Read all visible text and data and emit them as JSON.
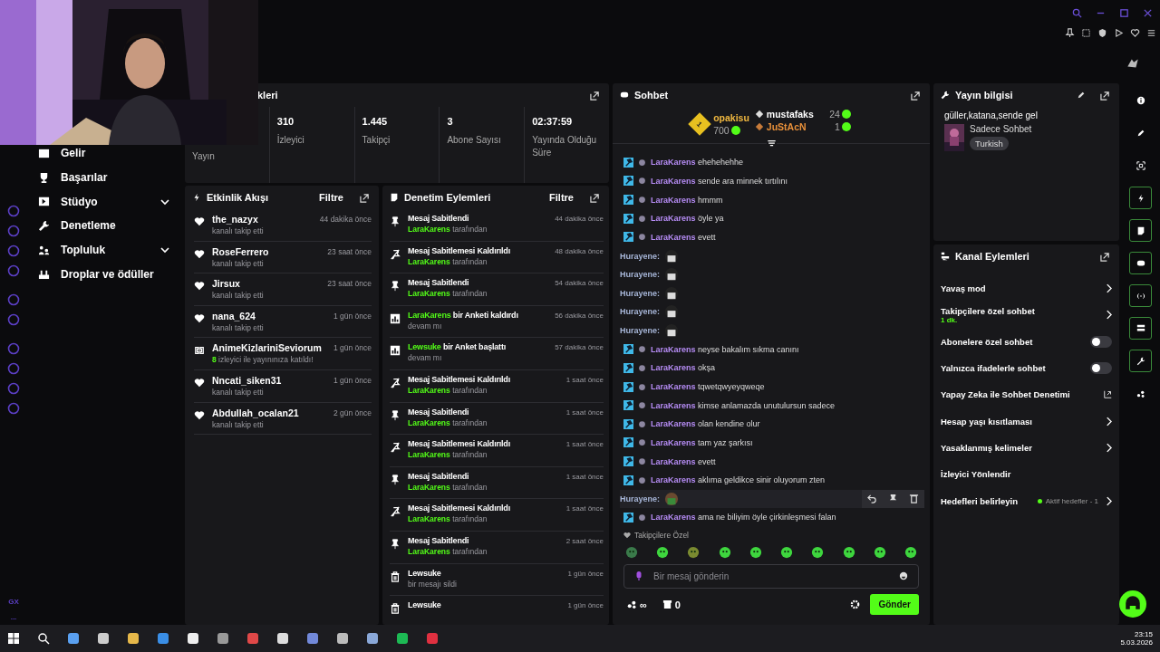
{
  "stats": {
    "title": "kleri",
    "items": [
      {
        "label": "Yayın"
      },
      {
        "value": "310",
        "label": "İzleyici"
      },
      {
        "value": "1.445",
        "label": "Takipçi"
      },
      {
        "value": "3",
        "label": "Abone Sayısı"
      },
      {
        "value": "02:37:59",
        "label": "Yayında Olduğu Süre"
      }
    ]
  },
  "nav": [
    {
      "label": "Gelir",
      "expandable": false
    },
    {
      "label": "Başarılar",
      "expandable": false
    },
    {
      "label": "Stüdyo",
      "expandable": true
    },
    {
      "label": "Denetleme",
      "expandable": false
    },
    {
      "label": "Topluluk",
      "expandable": true
    },
    {
      "label": "Droplar ve ödüller",
      "expandable": false
    }
  ],
  "browser_rail": {
    "badge": "GX",
    "more": "..."
  },
  "activity": {
    "title": "Etkinlik Akışı",
    "filter": "Filtre",
    "items": [
      {
        "kind": "follow",
        "user": "the_nazyx",
        "text": "kanalı takip etti",
        "time": "44 dakika önce"
      },
      {
        "kind": "follow",
        "user": "RoseFerrero",
        "text": "kanalı takip etti",
        "time": "23 saat önce"
      },
      {
        "kind": "follow",
        "user": "Jirsux",
        "text": "kanalı takip etti",
        "time": "23 saat önce"
      },
      {
        "kind": "follow",
        "user": "nana_624",
        "text": "kanalı takip etti",
        "time": "1 gün önce"
      },
      {
        "kind": "raid",
        "user": "AnimeKizlariniSeviorum",
        "count": "8",
        "text": "izleyici ile yayınınıza katıldı!",
        "time": "1 gün önce"
      },
      {
        "kind": "follow",
        "user": "Nncati_siken31",
        "text": "kanalı takip etti",
        "time": "1 gün önce"
      },
      {
        "kind": "follow",
        "user": "Abdullah_ocalan21",
        "text": "kanalı takip etti",
        "time": "2 gün önce"
      }
    ]
  },
  "moderation": {
    "title": "Denetim Eylemleri",
    "filter": "Filtre",
    "items": [
      {
        "kind": "pin",
        "title": "Mesaj Sabitlendi",
        "by_user": "LaraKarens",
        "by_text": "tarafından",
        "time": "44 dakika önce"
      },
      {
        "kind": "unpin",
        "title": "Mesaj Sabitlemesi Kaldırıldı",
        "by_user": "LaraKarens",
        "by_text": "tarafından",
        "time": "48 dakika önce"
      },
      {
        "kind": "pin",
        "title": "Mesaj Sabitlendi",
        "by_user": "LaraKarens",
        "by_text": "tarafından",
        "time": "54 dakika önce"
      },
      {
        "kind": "poll",
        "title_user": "LaraKarens",
        "title": "bir Anketi kaldırdı",
        "sub": "devam mı",
        "time": "56 dakika önce"
      },
      {
        "kind": "poll",
        "title_user": "Lewsuke",
        "title": "bir Anket başlattı",
        "sub": "devam mı",
        "time": "57 dakika önce"
      },
      {
        "kind": "unpin",
        "title": "Mesaj Sabitlemesi Kaldırıldı",
        "by_user": "LaraKarens",
        "by_text": "tarafından",
        "time": "1 saat önce"
      },
      {
        "kind": "pin",
        "title": "Mesaj Sabitlendi",
        "by_user": "LaraKarens",
        "by_text": "tarafından",
        "time": "1 saat önce"
      },
      {
        "kind": "unpin",
        "title": "Mesaj Sabitlemesi Kaldırıldı",
        "by_user": "LaraKarens",
        "by_text": "tarafından",
        "time": "1 saat önce"
      },
      {
        "kind": "pin",
        "title": "Mesaj Sabitlendi",
        "by_user": "LaraKarens",
        "by_text": "tarafından",
        "time": "1 saat önce"
      },
      {
        "kind": "unpin",
        "title": "Mesaj Sabitlemesi Kaldırıldı",
        "by_user": "LaraKarens",
        "by_text": "tarafından",
        "time": "1 saat önce"
      },
      {
        "kind": "pin",
        "title": "Mesaj Sabitlendi",
        "by_user": "LaraKarens",
        "by_text": "tarafından",
        "time": "2 saat önce"
      },
      {
        "kind": "delete",
        "title": "Lewsuke",
        "sub": "bir mesajı sildi",
        "time": "1 gün önce"
      },
      {
        "kind": "delete",
        "title": "Lewsuke",
        "time": "1 gün önce"
      }
    ]
  },
  "chat": {
    "title": "Sohbet",
    "leaders": [
      {
        "rank": "1",
        "user": "opakisu",
        "points": "700"
      },
      {
        "user": "mustafaks",
        "points": "24"
      },
      {
        "user": "JuStAcN",
        "points": "1"
      }
    ],
    "messages": [
      {
        "kind": "mod",
        "user": "LaraKarens",
        "text": "ehehehehhe",
        "hovered": false
      },
      {
        "kind": "mod",
        "user": "LaraKarens",
        "text": "sende ara minnek tırtılını",
        "hovered": false
      },
      {
        "kind": "mod",
        "user": "LaraKarens",
        "text": "hmmm",
        "hovered": false
      },
      {
        "kind": "mod",
        "user": "LaraKarens",
        "text": "öyle ya",
        "hovered": false
      },
      {
        "kind": "mod",
        "user": "LaraKarens",
        "text": "evett",
        "hovered": false
      },
      {
        "kind": "emote",
        "user": "Hurayene:",
        "hovered": false
      },
      {
        "kind": "emote",
        "user": "Hurayene:",
        "hovered": false
      },
      {
        "kind": "emote",
        "user": "Hurayene:",
        "hovered": false
      },
      {
        "kind": "emote",
        "user": "Hurayene:",
        "hovered": false
      },
      {
        "kind": "emote",
        "user": "Hurayene:",
        "hovered": false
      },
      {
        "kind": "mod",
        "user": "LaraKarens",
        "text": "neyse bakalım sıkma canını",
        "hovered": false
      },
      {
        "kind": "mod",
        "user": "LaraKarens",
        "text": "okşa",
        "hovered": false
      },
      {
        "kind": "mod",
        "user": "LaraKarens",
        "text": "tqwetqwyeyqweqe",
        "hovered": false
      },
      {
        "kind": "mod",
        "user": "LaraKarens",
        "text": "kimse anlamazda unutulursun sadece",
        "hovered": false
      },
      {
        "kind": "mod",
        "user": "LaraKarens",
        "text": "olan kendine olur",
        "hovered": false
      },
      {
        "kind": "mod",
        "user": "LaraKarens",
        "text": "tam yaz şarkısı",
        "hovered": false
      },
      {
        "kind": "mod",
        "user": "LaraKarens",
        "text": "evett",
        "hovered": false
      },
      {
        "kind": "mod",
        "user": "LaraKarens",
        "text": "aklıma geldikce sinir oluyorum zten",
        "hovered": false
      },
      {
        "kind": "emote",
        "user": "Hurayene:",
        "hovered": true
      },
      {
        "kind": "mod",
        "user": "LaraKarens",
        "text": "ama ne biliyim öyle çirkinleşmesi falan",
        "hovered": false
      }
    ],
    "emote_section": "Takipçilere Özel",
    "input": {
      "placeholder": "Bir mesaj gönderin"
    },
    "points": "∞",
    "store": "0",
    "send": "Gönder"
  },
  "stream_info": {
    "title": "Yayın bilgisi",
    "stream_title": "güller,katana,sende gel",
    "category": "Sadece Sohbet",
    "tag": "Turkish"
  },
  "channel_actions": {
    "title": "Kanal Eylemleri",
    "items": [
      {
        "kind": "chevron",
        "label": "Yavaş mod"
      },
      {
        "kind": "chevron",
        "label": "Takipçilere özel sohbet",
        "sub": "1 dk."
      },
      {
        "kind": "toggle",
        "label": "Abonelere özel sohbet",
        "on": false
      },
      {
        "kind": "toggle",
        "label": "Yalnızca ifadelerle sohbet",
        "on": false
      },
      {
        "kind": "external",
        "label": "Yapay Zeka ile Sohbet Denetimi"
      },
      {
        "kind": "chevron",
        "label": "Hesap yaşı kısıtlaması"
      },
      {
        "kind": "chevron",
        "label": "Yasaklanmış kelimeler"
      },
      {
        "kind": "plain",
        "label": "İzleyici Yönlendir"
      },
      {
        "kind": "goal",
        "label": "Hedefleri belirleyin",
        "status": "Aktif hedefler - 1"
      }
    ]
  },
  "right_rail": [
    {
      "highlighted": false
    },
    {
      "highlighted": false
    },
    {
      "highlighted": false
    },
    {
      "highlighted": true
    },
    {
      "highlighted": true
    },
    {
      "highlighted": true
    },
    {
      "highlighted": true
    },
    {
      "highlighted": true
    },
    {
      "highlighted": true
    },
    {
      "highlighted": false
    }
  ],
  "taskbar": {
    "time": "23:15",
    "date": "5.03.2026"
  }
}
